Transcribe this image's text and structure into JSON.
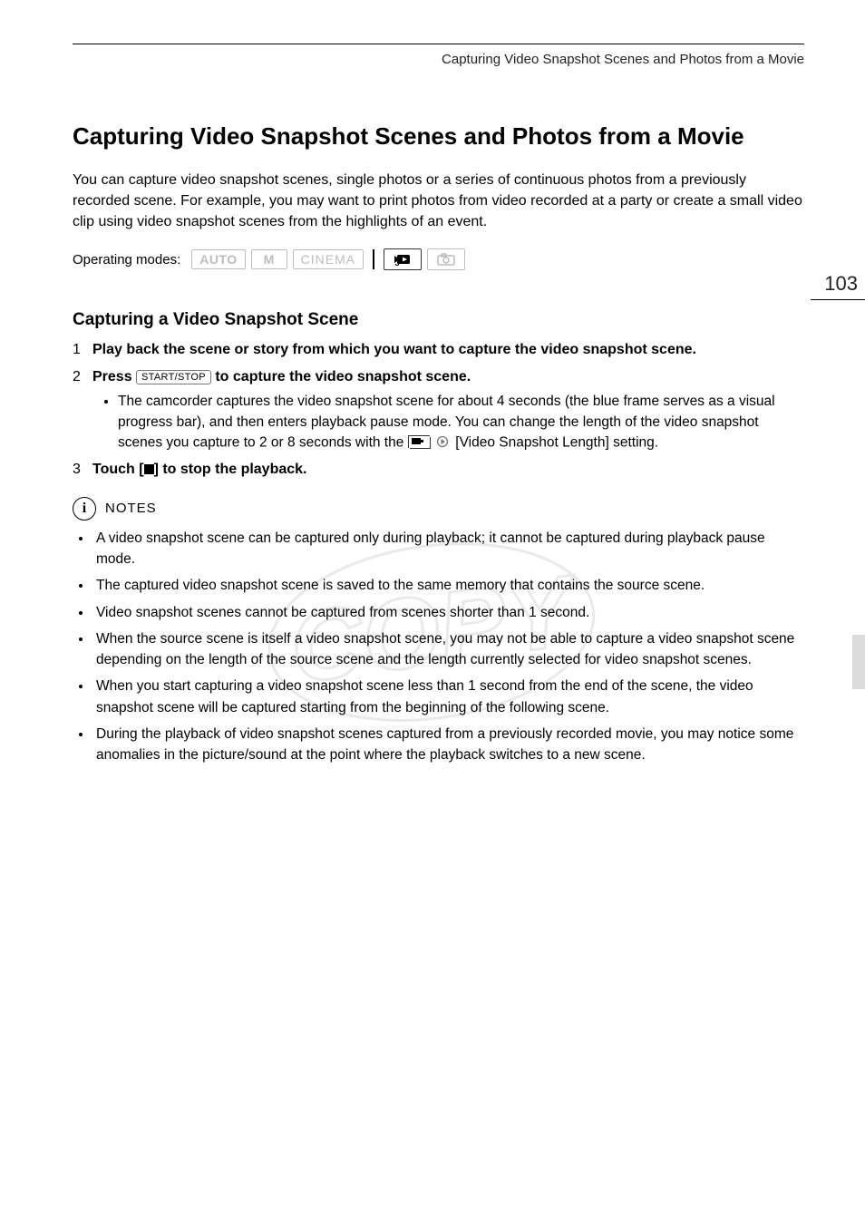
{
  "running_head": "Capturing Video Snapshot Scenes and Photos from a Movie",
  "page_number": "103",
  "title": "Capturing Video Snapshot Scenes and Photos from a Movie",
  "intro": "You can capture video snapshot scenes, single photos or a series of continuous photos from a previously recorded scene. For example, you may want to print photos from video recorded at a party or create a small video clip using video snapshot scenes from the highlights of an event.",
  "operating_modes": {
    "label": "Operating modes:",
    "auto": "AUTO",
    "m": "M",
    "cinema": "CINEMA"
  },
  "section_heading": "Capturing a Video Snapshot Scene",
  "steps": {
    "s1": "Play back the scene or story from which you want to capture the video snapshot scene.",
    "s2_pre": "Press ",
    "s2_key": "START/STOP",
    "s2_post": " to capture the video snapshot scene.",
    "s2_sub_pre": "The camcorder captures the video snapshot scene for about 4 seconds (the blue frame serves as a visual progress bar), and then enters playback pause mode. You can change the length of the video snapshot scenes you capture to 2 or 8 seconds with the ",
    "s2_sub_post": " [Video Snapshot Length] setting.",
    "s3_pre": "Touch [",
    "s3_post": "] to stop the playback."
  },
  "notes": {
    "icon_letter": "i",
    "label": "NOTES",
    "items": [
      "A video snapshot scene can be captured only during playback; it cannot be captured during playback pause mode.",
      "The captured video snapshot scene is saved to the same memory that contains the source scene.",
      "Video snapshot scenes cannot be captured from scenes shorter than 1 second.",
      "When the source scene is itself a video snapshot scene, you may not be able to capture a video snapshot scene depending on the length of the source scene and the length currently selected for video snapshot scenes.",
      "When you start capturing a video snapshot scene less than 1 second from the end of the scene, the video snapshot scene will be captured starting from the beginning of the following scene.",
      "During the playback of video snapshot scenes captured from a previously recorded movie, you may notice some anomalies in the picture/sound at the point where the playback switches to a new scene."
    ]
  },
  "watermark_text": "COPY"
}
